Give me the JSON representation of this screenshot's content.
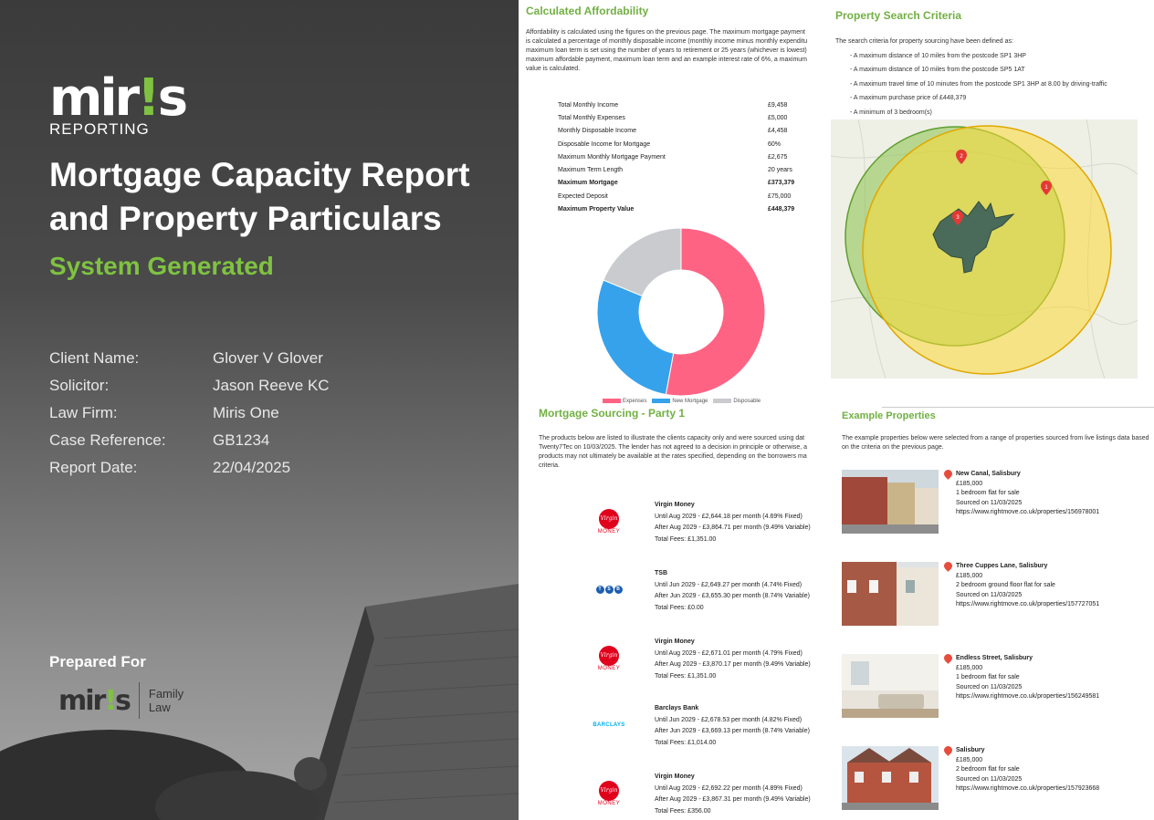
{
  "cover": {
    "logo_word_a": "mir",
    "logo_word_b": "!",
    "logo_word_c": "s",
    "logo_sub": "REPORTING",
    "title_line1": "Mortgage Capacity Report",
    "title_line2": "and Property Particulars",
    "subtitle": "System Generated",
    "info": [
      {
        "label": "Client Name:",
        "value": "Glover V Glover"
      },
      {
        "label": "Solicitor:",
        "value": "Jason Reeve KC"
      },
      {
        "label": "Law Firm:",
        "value": "Miris One"
      },
      {
        "label": "Case Reference:",
        "value": "GB1234"
      },
      {
        "label": "Report Date:",
        "value": "22/04/2025"
      }
    ],
    "prepared_for": "Prepared For",
    "partner_logo_a": "mir",
    "partner_logo_b": "!",
    "partner_logo_c": "s",
    "partner_family_1": "Family",
    "partner_family_2": "Law"
  },
  "affordability": {
    "heading": "Calculated Affordability",
    "intro_lines": [
      "Affordability is calculated using the figures on the previous page. The maximum mortgage payment",
      "is calculated a percentage of monthly disposable income (monthly income minus monthly expenditu",
      "maximum loan term is set using the number of years to retirement or 25 years (whichever is lowest)",
      "maximum affordable payment, maximum loan term and an example interest rate of 6%, a maximum",
      "value is calculated."
    ],
    "rows": [
      {
        "label": "Total Monthly Income",
        "value": "£9,458",
        "bold": false
      },
      {
        "label": "Total Monthly Expenses",
        "value": "£5,000",
        "bold": false
      },
      {
        "label": "Monthly Disposable Income",
        "value": "£4,458",
        "bold": false
      },
      {
        "label": "Disposable Income for Mortgage",
        "value": "60%",
        "bold": false
      },
      {
        "label": "Maximum Monthly Mortgage Payment",
        "value": "£2,675",
        "bold": false
      },
      {
        "label": "Maximum Term Length",
        "value": "20 years",
        "bold": false
      },
      {
        "label": "Maximum Mortgage",
        "value": "£373,379",
        "bold": true
      },
      {
        "label": "Expected Deposit",
        "value": "£75,000",
        "bold": false
      },
      {
        "label": "Maximum Property Value",
        "value": "£448,379",
        "bold": true
      }
    ]
  },
  "chart_data": {
    "type": "pie",
    "donut": true,
    "categories": [
      "Expenses",
      "New Mortgage",
      "Disposable"
    ],
    "values": [
      52.9,
      28.3,
      18.8
    ],
    "colors": [
      "#ff6384",
      "#36a2eb",
      "#c9cbcf"
    ],
    "legend": "bottom",
    "title": ""
  },
  "sourcing": {
    "heading": "Mortgage Sourcing - Party 1",
    "intro_lines": [
      "The products below are listed to illustrate the clients capacity only and were sourced using dat",
      "Twenty7Tec on 10/03/2025. The lender has not agreed to a decision in principle or otherwise, a",
      "products may not ultimately be available at the rates specified, depending on the borrowers ma",
      "criteria."
    ],
    "products": [
      {
        "logo": "virgin-money-logo",
        "logo_text": "MONEY",
        "name": "Virgin Money",
        "line1": "Until Aug 2029 - £2,644.18 per month (4.69% Fixed)",
        "line2": "After Aug 2029 - £3,864.71 per month (9.49% Variable)",
        "fees": "Total Fees: £1,351.00"
      },
      {
        "logo": "tsb-logo",
        "logo_text": "TSB",
        "name": "TSB",
        "line1": "Until Jun 2029 - £2,649.27 per month (4.74% Fixed)",
        "line2": "After Jun 2029 - £3,655.30 per month (8.74% Variable)",
        "fees": "Total Fees: £0.00"
      },
      {
        "logo": "virgin-money-logo",
        "logo_text": "MONEY",
        "name": "Virgin Money",
        "line1": "Until Aug 2029 - £2,671.01 per month (4.79% Fixed)",
        "line2": "After Aug 2029 - £3,870.17 per month (9.49% Variable)",
        "fees": "Total Fees: £1,351.00"
      },
      {
        "logo": "barclays-logo",
        "logo_text": "BARCLAYS",
        "name": "Barclays Bank",
        "line1": "Until Jun 2029 - £2,678.53 per month (4.82% Fixed)",
        "line2": "After Jun 2029 - £3,669.13 per month (8.74% Variable)",
        "fees": "Total Fees: £1,014.00"
      },
      {
        "logo": "virgin-money-logo",
        "logo_text": "MONEY",
        "name": "Virgin Money",
        "line1": "Until Aug 2029 - £2,692.22 per month (4.89% Fixed)",
        "line2": "After Aug 2029 - £3,867.31 per month (9.49% Variable)",
        "fees": "Total Fees: £356.00"
      }
    ]
  },
  "criteria": {
    "heading": "Property Search Criteria",
    "intro": "The search criteria for property sourcing have been defined as:",
    "items": [
      "- A maximum distance of 10 miles from the postcode SP1 3HP",
      "- A maximum distance of 10 miles from the postcode SP5 1AT",
      "- A maximum travel time of 10 minutes from the postcode SP1 3HP at 8.00 by driving-traffic",
      "- A maximum purchase price of £448,379",
      "- A minimum of 3 bedroom(s)"
    ],
    "map_pins": [
      "1",
      "2",
      "3"
    ],
    "zone_colors": {
      "green": "#7cb342",
      "yellow": "#fdd835",
      "drive": "#4a6b5a"
    }
  },
  "examples": {
    "heading": "Example Properties",
    "intro_lines": [
      "The example properties below were selected from a range of properties sourced from live listings data based",
      "on the criteria on the previous page."
    ],
    "properties": [
      {
        "name": "New Canal, Salisbury",
        "price": "£185,000",
        "desc": "1 bedroom flat for sale",
        "sourced": "Sourced on 11/03/2025",
        "url": "https://www.rightmove.co.uk/properties/156978001"
      },
      {
        "name": "Three Cuppes Lane, Salisbury",
        "price": "£185,000",
        "desc": "2 bedroom ground floor flat for sale",
        "sourced": "Sourced on 11/03/2025",
        "url": "https://www.rightmove.co.uk/properties/157727051"
      },
      {
        "name": "Endless Street, Salisbury",
        "price": "£185,000",
        "desc": "1 bedroom flat for sale",
        "sourced": "Sourced on 11/03/2025",
        "url": "https://www.rightmove.co.uk/properties/156249581"
      },
      {
        "name": "Salisbury",
        "price": "£185,000",
        "desc": "2 bedroom flat for sale",
        "sourced": "Sourced on 11/03/2025",
        "url": "https://www.rightmove.co.uk/properties/157923668"
      }
    ]
  }
}
